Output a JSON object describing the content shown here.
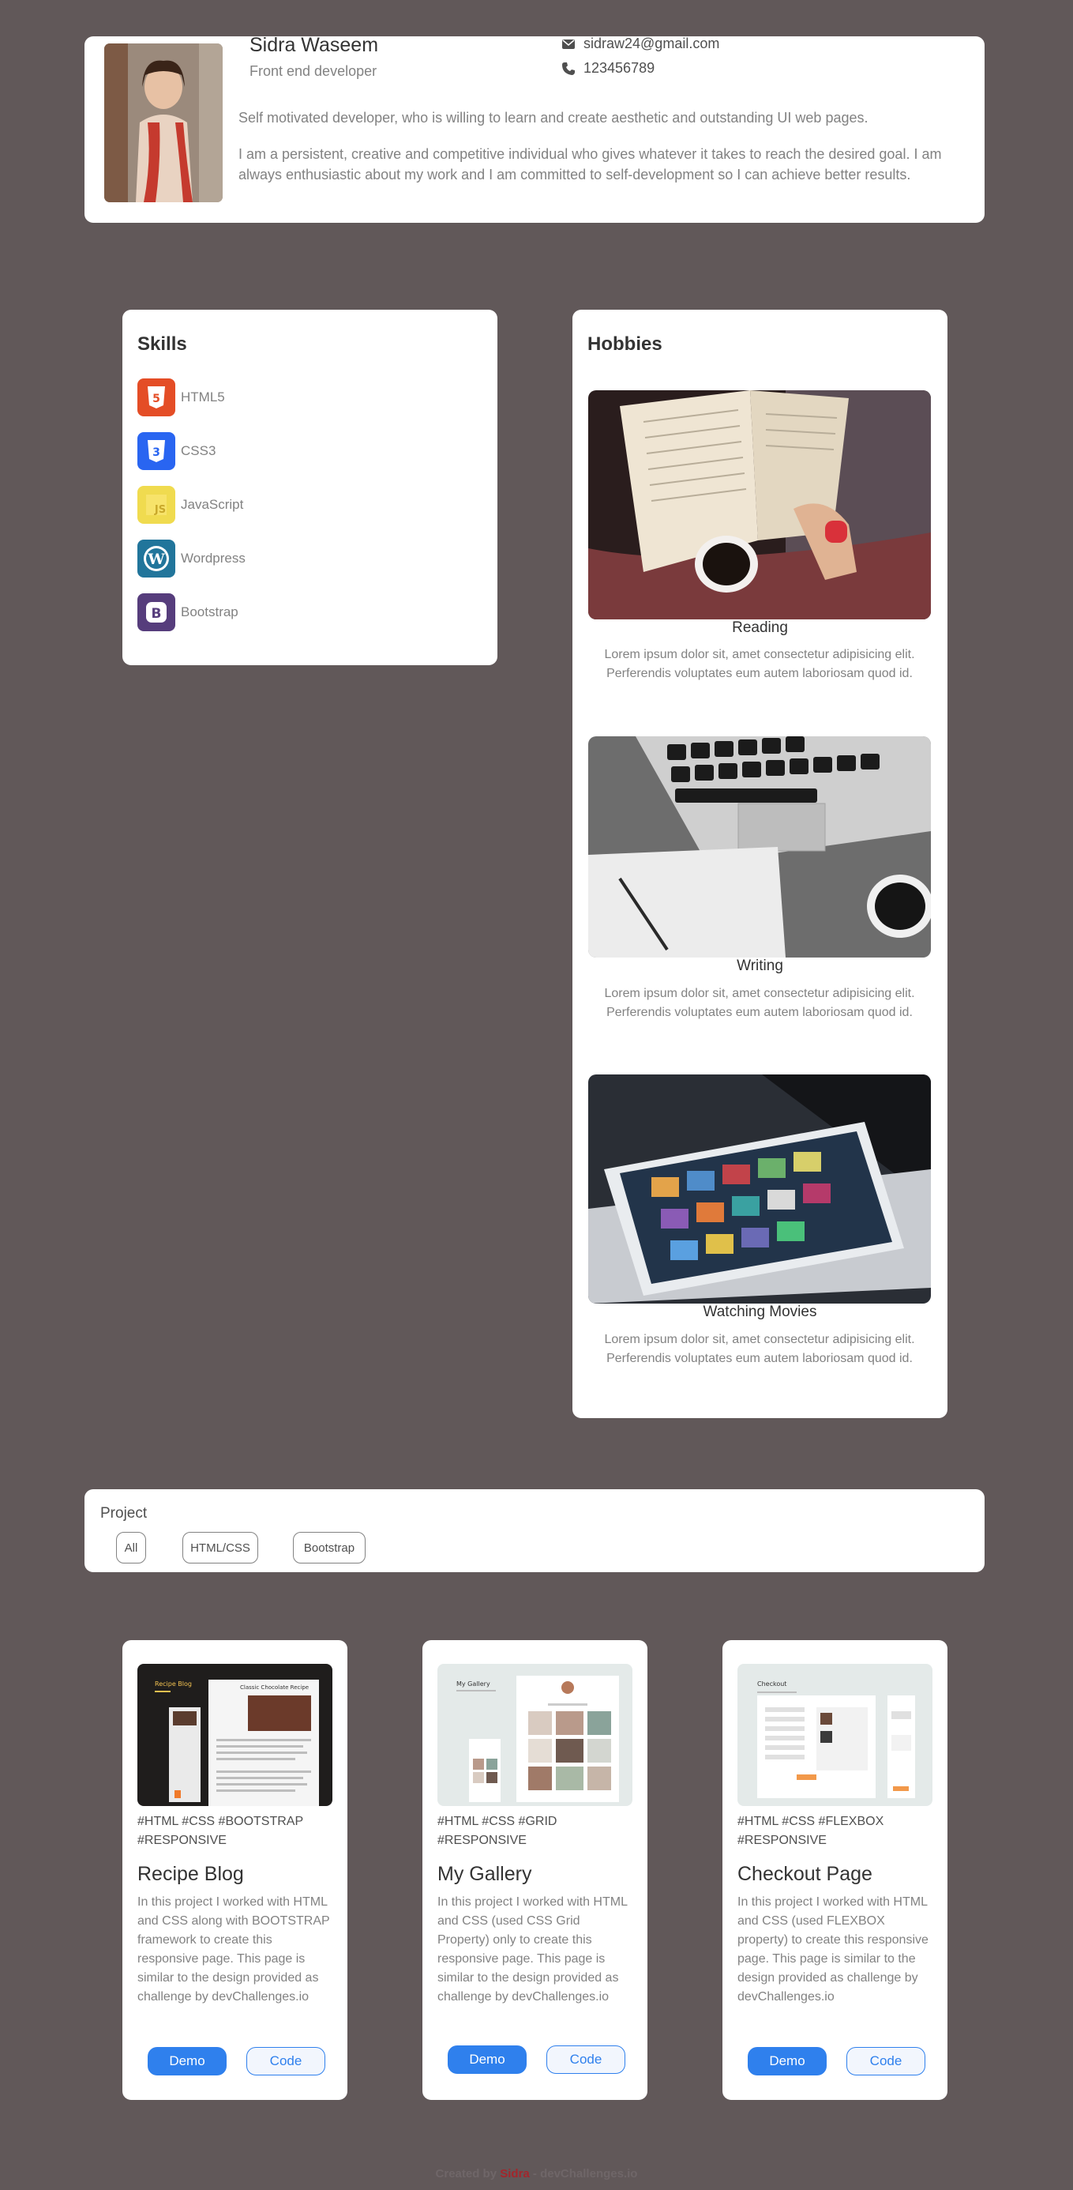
{
  "profile": {
    "name": "Sidra Waseem",
    "role": "Front end developer",
    "email": "sidraw24@gmail.com",
    "phone": "123456789",
    "bio_short": "Self motivated developer, who is willing to learn and create aesthetic and outstanding UI web pages.",
    "bio_long": "I am a persistent, creative and competitive individual who gives whatever it takes to reach the desired goal. I am always enthusiastic about my work and I am committed to self-development so I can achieve better results."
  },
  "skills": {
    "title": "Skills",
    "items": [
      {
        "label": "HTML5",
        "icon": "html5-icon",
        "color": "#e44d26"
      },
      {
        "label": "CSS3",
        "icon": "css3-icon",
        "color": "#2965f1"
      },
      {
        "label": "JavaScript",
        "icon": "javascript-icon",
        "color": "#f0db4f"
      },
      {
        "label": "Wordpress",
        "icon": "wordpress-icon",
        "color": "#21759b"
      },
      {
        "label": "Bootstrap",
        "icon": "bootstrap-icon",
        "color": "#563d7c"
      }
    ]
  },
  "hobbies": {
    "title": "Hobbies",
    "items": [
      {
        "title": "Reading",
        "text": "Lorem ipsum dolor sit, amet consectetur adipisicing elit. Perferendis voluptates eum autem laboriosam quod id."
      },
      {
        "title": "Writing",
        "text": "Lorem ipsum dolor sit, amet consectetur adipisicing elit. Perferendis voluptates eum autem laboriosam quod id."
      },
      {
        "title": "Watching Movies",
        "text": "Lorem ipsum dolor sit, amet consectetur adipisicing elit. Perferendis voluptates eum autem laboriosam quod id."
      }
    ]
  },
  "project_filter": {
    "label": "Project",
    "filters": [
      "All",
      "HTML/CSS",
      "Bootstrap"
    ]
  },
  "projects": [
    {
      "tags": "#HTML #CSS #BOOTSTRAP #RESPONSIVE",
      "title": "Recipe Blog",
      "desc": "In this project I worked with HTML and CSS along with BOOTSTRAP framework to create this responsive page. This page is similar to the design provided as challenge by devChallenges.io",
      "demo": "Demo",
      "code": "Code"
    },
    {
      "tags": "#HTML #CSS #GRID #RESPONSIVE",
      "title": "My Gallery",
      "desc": "In this project I worked with HTML and CSS (used CSS Grid Property) only to create this responsive page. This page is similar to the design provided as challenge by devChallenges.io",
      "demo": "Demo",
      "code": "Code"
    },
    {
      "tags": "#HTML #CSS #FLEXBOX #RESPONSIVE",
      "title": "Checkout Page",
      "desc": "In this project I worked with HTML and CSS (used FLEXBOX property) to create this responsive page. This page is similar to the design provided as challenge by devChallenges.io",
      "demo": "Demo",
      "code": "Code"
    }
  ],
  "thumbnails": {
    "recipe": {
      "heading": "Recipe Blog",
      "article": "Classic Chocolate Recipe"
    },
    "gallery": {
      "heading": "My Gallery"
    },
    "checkout": {
      "heading": "Checkout"
    }
  },
  "footer": {
    "prefix": "Created by",
    "author": "Sidra",
    "suffix": "- devChallenges.io"
  }
}
